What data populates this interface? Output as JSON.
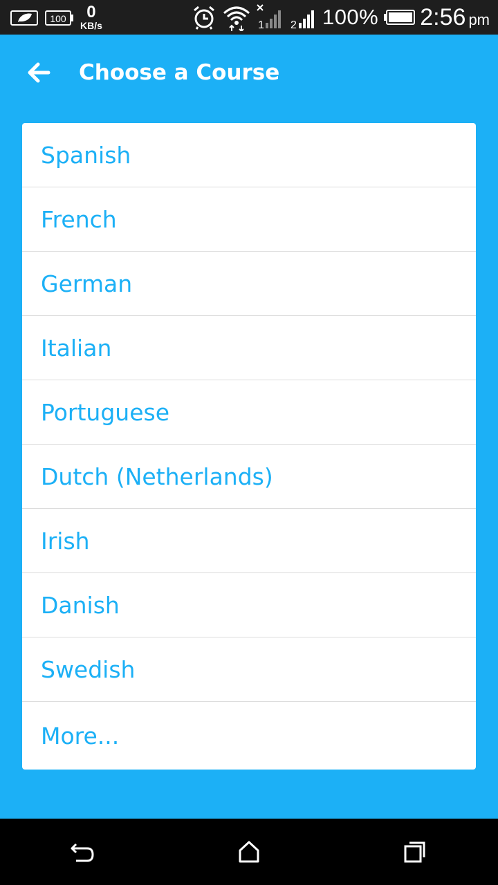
{
  "status_bar": {
    "net_speed": "0",
    "net_unit": "KB/s",
    "sim1": "1",
    "sim2": "2",
    "battery_percent": "100%",
    "time": "2:56",
    "ampm": "pm",
    "icons": [
      "leaf-icon",
      "battery-100-icon",
      "alarm-icon",
      "wifi-icon",
      "signal-icon",
      "battery-icon"
    ]
  },
  "app_bar": {
    "title": "Choose a Course",
    "back_icon": "arrow-left-icon"
  },
  "courses": [
    {
      "label": "Spanish"
    },
    {
      "label": "French"
    },
    {
      "label": "German"
    },
    {
      "label": "Italian"
    },
    {
      "label": "Portuguese"
    },
    {
      "label": "Dutch (Netherlands)"
    },
    {
      "label": "Irish"
    },
    {
      "label": "Danish"
    },
    {
      "label": "Swedish"
    },
    {
      "label": "More..."
    }
  ],
  "nav_bar": {
    "icons": [
      "back-icon",
      "home-icon",
      "recent-apps-icon"
    ]
  },
  "colors": {
    "accent": "#1cb0f6",
    "status_bar": "#1e1e1e",
    "nav_bar": "#000000",
    "card": "#ffffff"
  }
}
